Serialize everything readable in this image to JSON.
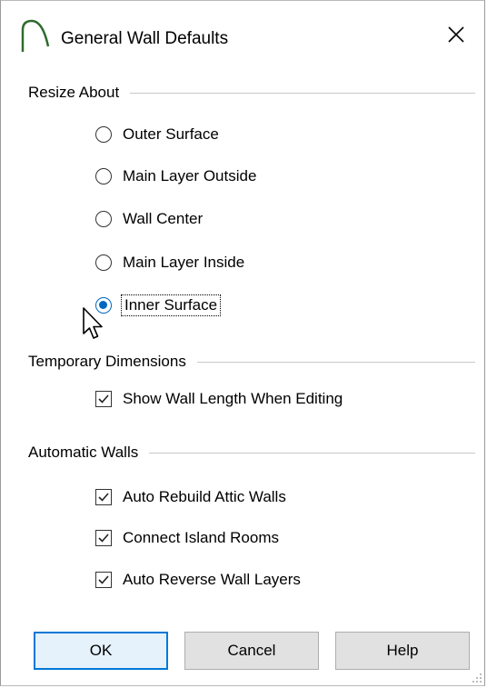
{
  "window": {
    "title": "General Wall Defaults",
    "close_symbol": "✕",
    "icon": "app-arch-icon"
  },
  "resize_about": {
    "label": "Resize About",
    "options": [
      {
        "label": "Outer Surface",
        "selected": false
      },
      {
        "label": "Main Layer Outside",
        "selected": false
      },
      {
        "label": "Wall Center",
        "selected": false
      },
      {
        "label": "Main Layer Inside",
        "selected": false
      },
      {
        "label": "Inner Surface",
        "selected": true
      }
    ]
  },
  "temporary_dimensions": {
    "label": "Temporary Dimensions",
    "checkboxes": [
      {
        "label": "Show Wall Length When Editing",
        "checked": true
      }
    ]
  },
  "automatic_walls": {
    "label": "Automatic Walls",
    "checkboxes": [
      {
        "label": "Auto Rebuild Attic Walls",
        "checked": true
      },
      {
        "label": "Connect Island Rooms",
        "checked": true
      },
      {
        "label": "Auto Reverse Wall Layers",
        "checked": true
      }
    ]
  },
  "buttons": {
    "ok": "OK",
    "cancel": "Cancel",
    "help": "Help"
  },
  "colors": {
    "accent": "#0078d7",
    "radio_selected": "#0067c0",
    "button_face": "#e1e1e1"
  }
}
